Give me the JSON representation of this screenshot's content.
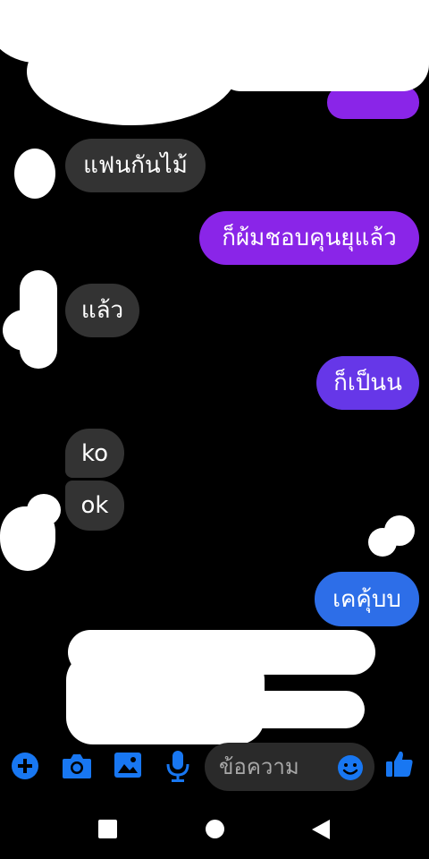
{
  "conversation": {
    "messages": [
      {
        "from": "other",
        "text": "แฟนกันไม้"
      },
      {
        "from": "me",
        "text": "ก็ผ้มชอบคุนยุแล้ว"
      },
      {
        "from": "other",
        "text": "แล้ว"
      },
      {
        "from": "me",
        "text": "ก็เป็นน"
      },
      {
        "from": "other",
        "text": "ko"
      },
      {
        "from": "other",
        "text": "ok"
      },
      {
        "from": "me",
        "text": "เคคุ้บบ"
      }
    ]
  },
  "composer": {
    "placeholder": "ข้อความ",
    "value": ""
  },
  "icons": {
    "add": "plus-circle-icon",
    "camera": "camera-icon",
    "gallery": "image-icon",
    "voice": "microphone-icon",
    "emoji": "smiley-icon",
    "like": "thumbs-up-icon",
    "nav_recents": "square-icon",
    "nav_home": "circle-icon",
    "nav_back": "back-triangle-icon"
  },
  "colors": {
    "background": "#000000",
    "incoming_bubble": "#333333",
    "outgoing_purple": "#8a25e8",
    "outgoing_violet": "#6637e8",
    "outgoing_blue": "#2d6ee8",
    "accent": "#1877f2"
  }
}
